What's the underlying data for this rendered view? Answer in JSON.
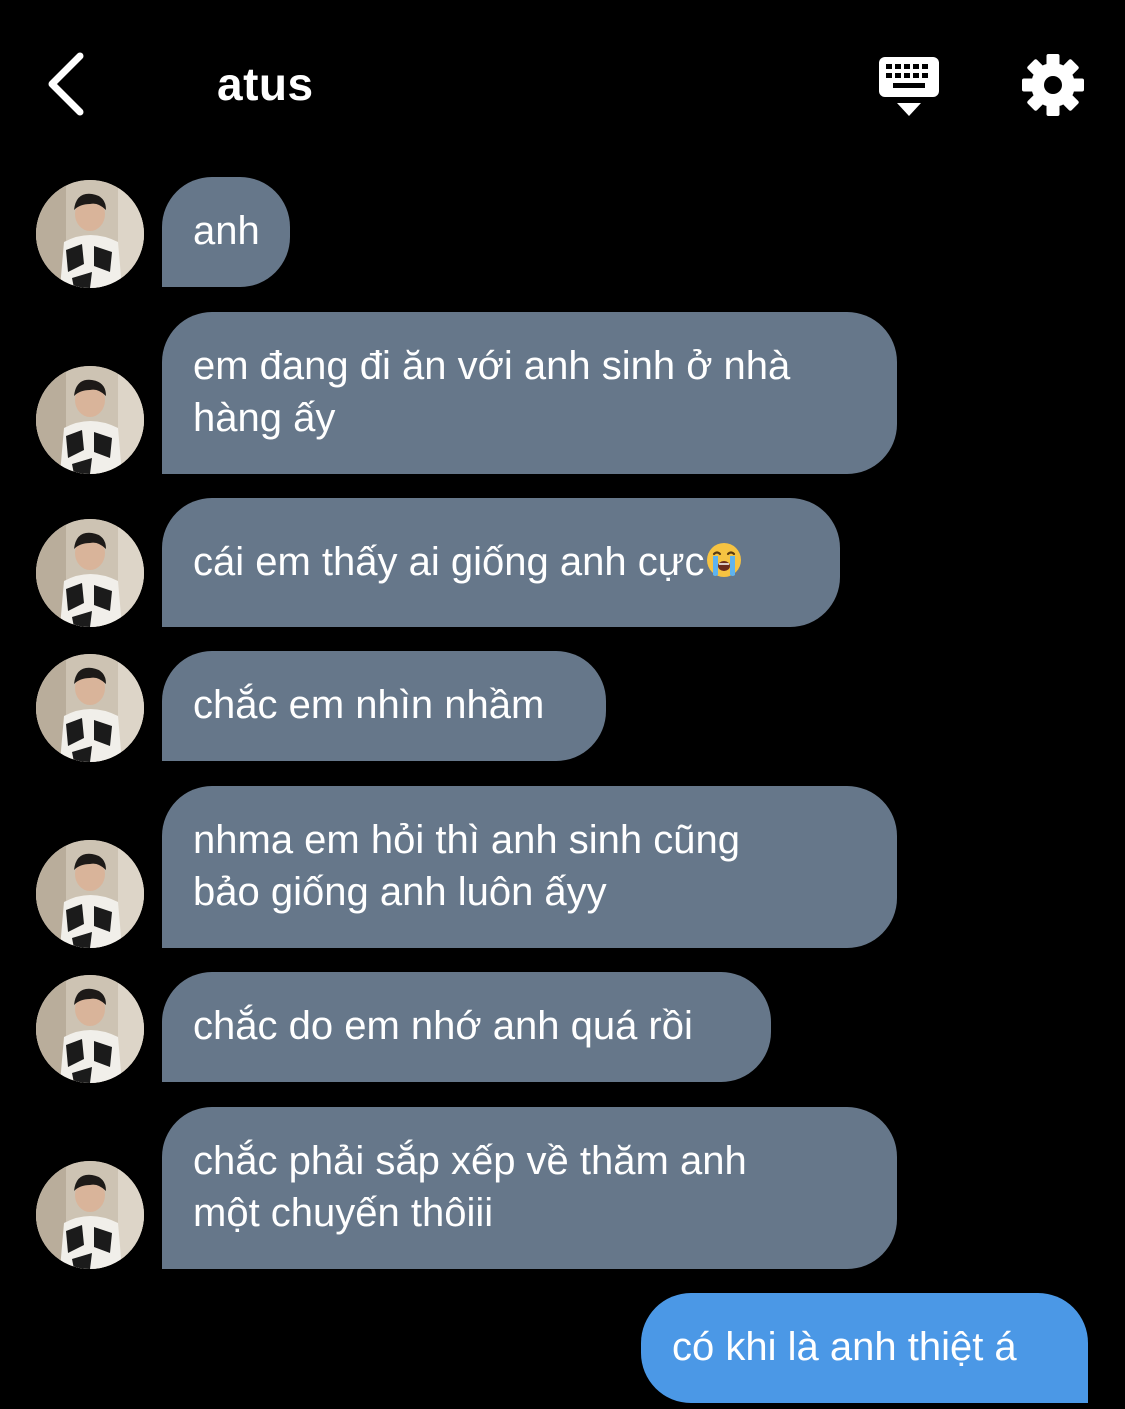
{
  "header": {
    "title": "atus",
    "icons": {
      "back": "chevron-left-icon",
      "keyboard": "keyboard-icon",
      "settings": "gear-icon"
    }
  },
  "colors": {
    "background": "#000000",
    "received_bubble": "#66778a",
    "sent_bubble": "#4b98e6",
    "text": "#ffffff"
  },
  "messages": [
    {
      "direction": "received",
      "text": "anh"
    },
    {
      "direction": "received",
      "text": "em đang đi ăn với anh sinh ở nhà\nhàng ấy"
    },
    {
      "direction": "received",
      "text": "cái em thấy ai giống anh cực",
      "emoji": "loudly-crying-face-icon"
    },
    {
      "direction": "received",
      "text": "chắc em nhìn nhầm"
    },
    {
      "direction": "received",
      "text": "nhma em hỏi thì anh sinh cũng\nbảo giống anh luôn ấyy"
    },
    {
      "direction": "received",
      "text": "chắc do em nhớ anh quá rồi"
    },
    {
      "direction": "received",
      "text": "chắc phải sắp xếp về thăm anh\nmột chuyến thôiii"
    },
    {
      "direction": "sent",
      "text": "có khi là anh thiệt á"
    }
  ]
}
